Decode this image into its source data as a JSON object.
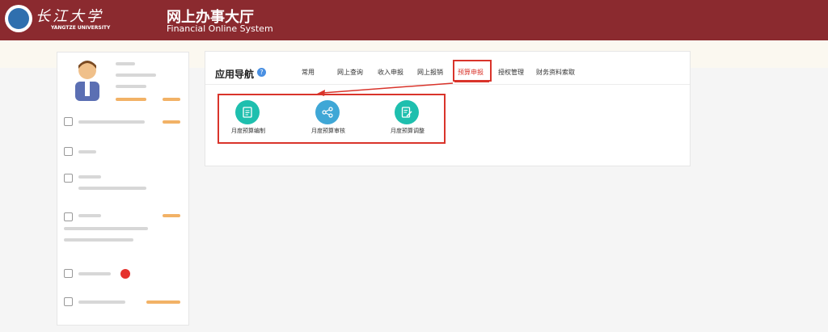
{
  "header": {
    "logo_cn": "长江大学",
    "logo_en": "YANGTZE UNIVERSITY",
    "title": "网上办事大厅",
    "subtitle": "Financial  Online  System"
  },
  "app_nav": {
    "title": "应用导航",
    "help_icon": "question-icon",
    "help_glyph": "?",
    "tabs": [
      "常用",
      "网上查询",
      "收入申报",
      "网上报销",
      "预算申报",
      "授权管理",
      "财务资料索取"
    ],
    "active_tab": "预算申报",
    "apps": [
      {
        "label": "月度预算编制",
        "icon": "document-icon",
        "color": "#1ebfae"
      },
      {
        "label": "月度预算审核",
        "icon": "share-icon",
        "color": "#3fa7d6"
      },
      {
        "label": "月度预算调整",
        "icon": "edit-document-icon",
        "color": "#1ebfae"
      }
    ]
  },
  "colors": {
    "header_bg": "#8b2a2f",
    "accent_red": "#d9342b",
    "teal": "#1ebfae"
  }
}
